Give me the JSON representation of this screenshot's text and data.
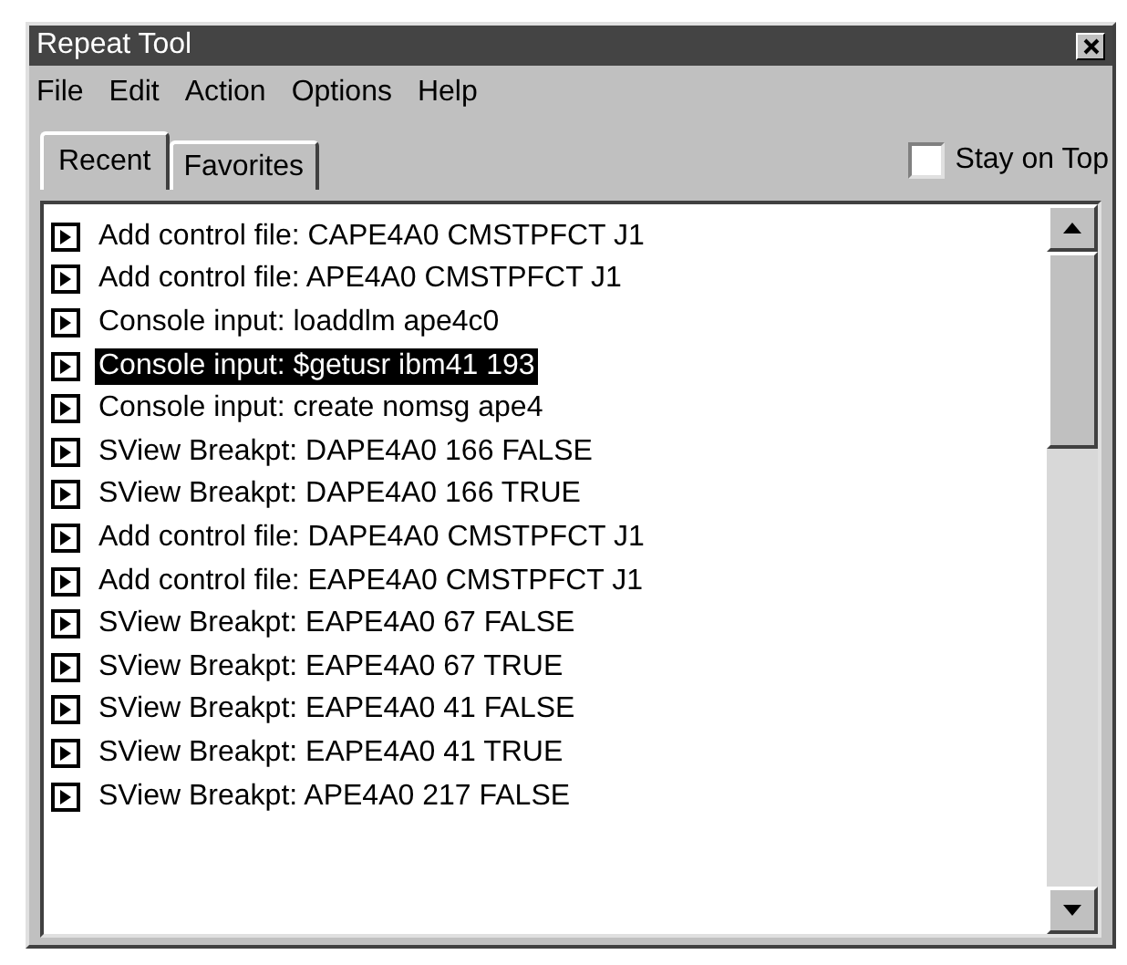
{
  "window": {
    "title": "Repeat Tool"
  },
  "menu": [
    "File",
    "Edit",
    "Action",
    "Options",
    "Help"
  ],
  "tabs": [
    {
      "label": "Recent",
      "selected": true
    },
    {
      "label": "Favorites",
      "selected": false
    }
  ],
  "stay_on_top": {
    "label": "Stay on Top",
    "checked": false
  },
  "items": [
    {
      "text": "Add control file: CAPE4A0 CMSTPFCT J1",
      "selected": false
    },
    {
      "text": "Add control file: APE4A0 CMSTPFCT J1",
      "selected": false
    },
    {
      "text": "Console input: loaddlm ape4c0",
      "selected": false
    },
    {
      "text": "Console input: $getusr ibm41 193",
      "selected": true
    },
    {
      "text": "Console input: create nomsg ape4",
      "selected": false
    },
    {
      "text": "SView Breakpt: DAPE4A0 166 FALSE",
      "selected": false
    },
    {
      "text": "SView Breakpt: DAPE4A0 166 TRUE",
      "selected": false
    },
    {
      "text": "Add control file: DAPE4A0 CMSTPFCT J1",
      "selected": false
    },
    {
      "text": "Add control file: EAPE4A0 CMSTPFCT J1",
      "selected": false
    },
    {
      "text": "SView Breakpt: EAPE4A0 67 FALSE",
      "selected": false
    },
    {
      "text": "SView Breakpt: EAPE4A0 67 TRUE",
      "selected": false
    },
    {
      "text": "SView Breakpt: EAPE4A0 41 FALSE",
      "selected": false
    },
    {
      "text": "SView Breakpt: EAPE4A0 41 TRUE",
      "selected": false
    },
    {
      "text": "SView Breakpt: APE4A0 217 FALSE",
      "selected": false
    }
  ]
}
